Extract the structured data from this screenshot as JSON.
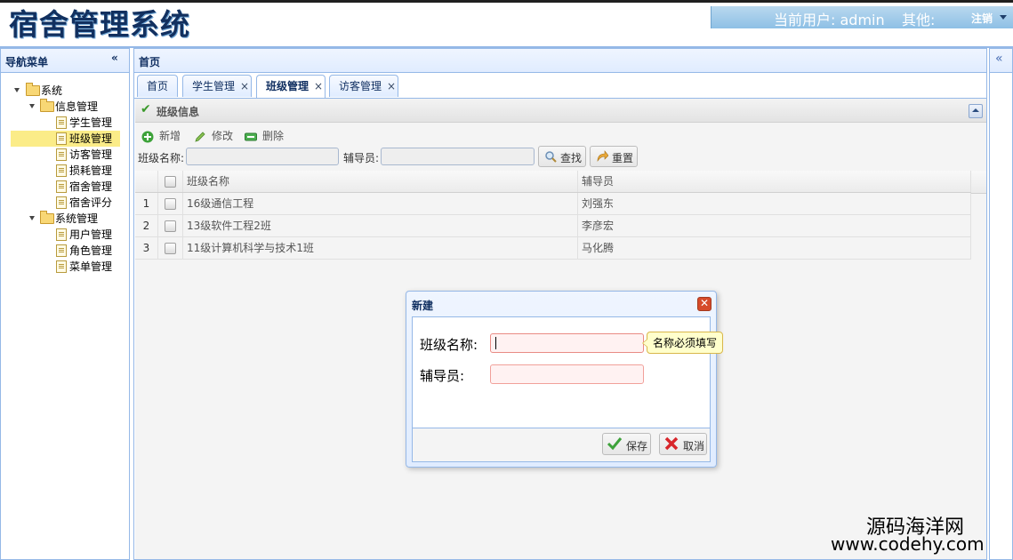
{
  "header": {
    "logo": "宿舍管理系统",
    "current_user_label": "当前用户:",
    "current_user": "admin",
    "other_label": "其他:",
    "logout": "注销"
  },
  "west": {
    "title": "导航菜单",
    "collapse_icon": "«",
    "tree": [
      {
        "label": "系统",
        "type": "folder",
        "level": 0
      },
      {
        "label": "信息管理",
        "type": "folder",
        "level": 1
      },
      {
        "label": "学生管理",
        "type": "file",
        "level": 2
      },
      {
        "label": "班级管理",
        "type": "file",
        "level": 2,
        "selected": true
      },
      {
        "label": "访客管理",
        "type": "file",
        "level": 2
      },
      {
        "label": "损耗管理",
        "type": "file",
        "level": 2
      },
      {
        "label": "宿舍管理",
        "type": "file",
        "level": 2
      },
      {
        "label": "宿舍评分",
        "type": "file",
        "level": 2
      },
      {
        "label": "系统管理",
        "type": "folder",
        "level": 1
      },
      {
        "label": "用户管理",
        "type": "file",
        "level": 2
      },
      {
        "label": "角色管理",
        "type": "file",
        "level": 2
      },
      {
        "label": "菜单管理",
        "type": "file",
        "level": 2
      }
    ]
  },
  "center": {
    "title": "首页",
    "tabs": [
      {
        "label": "首页",
        "closable": false
      },
      {
        "label": "学生管理",
        "closable": true
      },
      {
        "label": "班级管理",
        "closable": true,
        "active": true
      },
      {
        "label": "访客管理",
        "closable": true
      }
    ],
    "close_glyph": "×",
    "panel_title": "班级信息",
    "toolbar": {
      "add": "新增",
      "edit": "修改",
      "delete": "删除"
    },
    "search": {
      "class_name_label": "班级名称:",
      "class_name_value": "",
      "counselor_label": "辅导员:",
      "counselor_value": "",
      "search_button": "查找",
      "reset_button": "重置"
    },
    "grid": {
      "columns": [
        "班级名称",
        "辅导员"
      ],
      "rows": [
        {
          "num": "1",
          "name": "16级通信工程",
          "counselor": "刘强东"
        },
        {
          "num": "2",
          "name": "13级软件工程2班",
          "counselor": "李彦宏"
        },
        {
          "num": "3",
          "name": "11级计算机科学与技术1班",
          "counselor": "马化腾"
        }
      ]
    }
  },
  "east": {
    "collapse_icon": "«"
  },
  "dialog": {
    "title": "新建",
    "class_name_label": "班级名称:",
    "class_name_value": "",
    "counselor_label": "辅导员:",
    "counselor_value": "",
    "validation_tip": "名称必须填写",
    "save_button": "保存",
    "cancel_button": "取消"
  },
  "watermark": {
    "line1": "源码海洋网",
    "line2": "www.codehy.com"
  },
  "colors": {
    "accent": "#95b8e7",
    "header_text": "#12305f",
    "selected_row": "#fbec88",
    "error_border": "#f1a09a"
  }
}
